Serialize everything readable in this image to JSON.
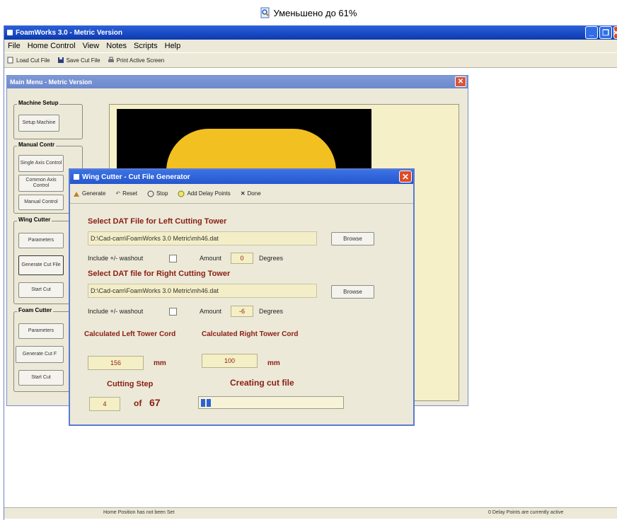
{
  "banner": {
    "text": "Уменьшено до 61%"
  },
  "app": {
    "title": "FoamWorks 3.0 - Metric Version",
    "menu": [
      "File",
      "Home Control",
      "View",
      "Notes",
      "Scripts",
      "Help"
    ],
    "toolbar": {
      "load": "Load Cut File",
      "save": "Save Cut File",
      "print": "Print Active Screen"
    },
    "status": {
      "left": "Home Position has not been Set",
      "right": "0 Delay Points are currently active"
    }
  },
  "main_menu": {
    "title": "Main Menu - Metric Version",
    "groups": {
      "machine_setup": {
        "label": "Machine Setup",
        "setup_machine": "Setup Machine"
      },
      "manual_control": {
        "label": "Manual Contr",
        "single_axis": "Single Axis Control",
        "common_axis": "Common Axis Control",
        "manual_control": "Manual Control"
      },
      "wing_cutter": {
        "label": "Wing Cutter",
        "parameters": "Parameters",
        "generate": "Generate Cut File",
        "start": "Start Cut"
      },
      "foam_cutter": {
        "label": "Foam Cutter",
        "parameters": "Parameters",
        "generate": "Generate Cut F",
        "start": "Start Cut"
      }
    }
  },
  "dialog": {
    "title": "Wing Cutter - Cut File Generator",
    "toolbar": {
      "generate": "Generate",
      "reset": "Reset",
      "stop": "Stop",
      "add_delay": "Add Delay Points",
      "done": "Done"
    },
    "left": {
      "heading": "Select DAT File for Left Cutting Tower",
      "path": "D:\\Cad-cam\\FoamWorks 3.0 Metric\\mh46.dat",
      "browse": "Browse",
      "washout_label": "Include +/- washout",
      "amount_label": "Amount",
      "amount_value": "0",
      "degrees": "Degrees"
    },
    "right": {
      "heading": "Select DAT file for Right Cutting Tower",
      "path": "D:\\Cad-cam\\FoamWorks 3.0 Metric\\mh46.dat",
      "browse": "Browse",
      "washout_label": "Include +/- washout",
      "amount_label": "Amount",
      "amount_value": "-6",
      "degrees": "Degrees"
    },
    "cord": {
      "left_label": "Calculated Left Tower Cord",
      "right_label": "Calculated Right Tower Cord",
      "left_value": "156",
      "right_value": "100",
      "unit": "mm"
    },
    "step": {
      "label": "Cutting Step",
      "current": "4",
      "of": "of",
      "total": "67",
      "status": "Creating cut file",
      "progress_fraction": 0.06
    }
  },
  "colors": {
    "accent": "#2b62d6",
    "label": "#8a1e14",
    "dialog_bg": "#ece9d8"
  }
}
